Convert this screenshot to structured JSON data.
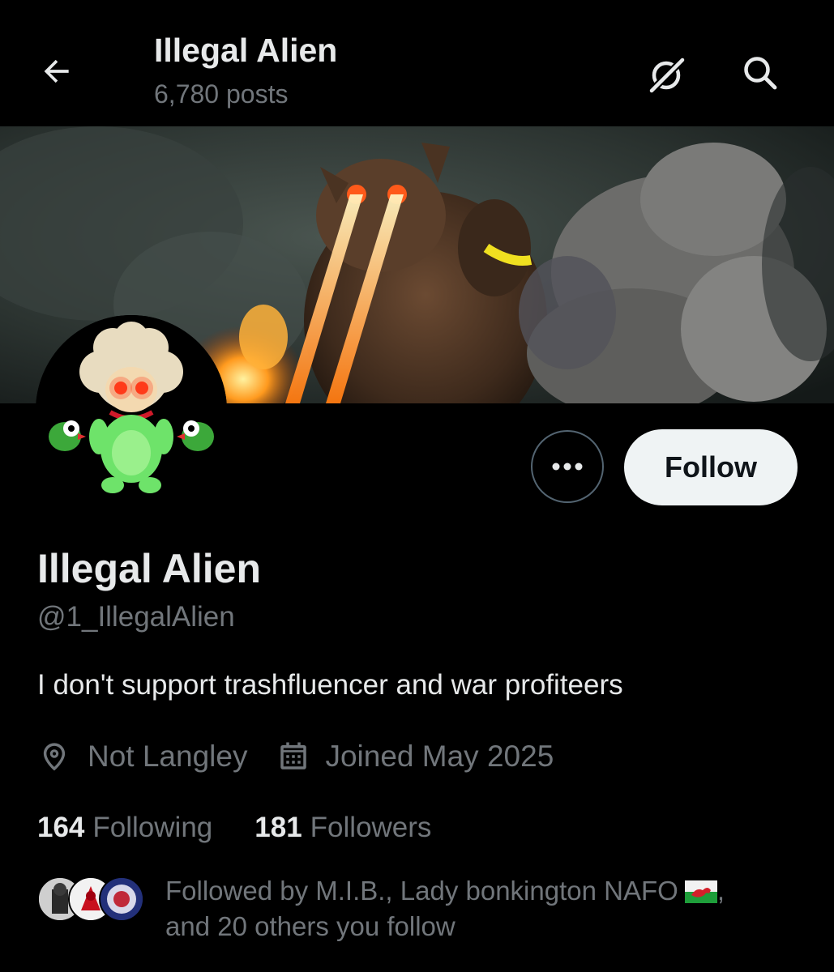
{
  "header": {
    "title": "Illegal Alien",
    "posts_count": "6,780 posts",
    "back_icon": "arrow-left-icon",
    "grok_icon": "grok-icon",
    "search_icon": "search-icon"
  },
  "profile": {
    "display_name": "Illegal Alien",
    "handle": "@1_IllegalAlien",
    "bio": "I don't support trashfluencer and war profiteers",
    "location": "Not Langley",
    "joined": "Joined May 2025",
    "following_count": "164",
    "following_label": "Following",
    "followers_count": "181",
    "followers_label": "Followers"
  },
  "actions": {
    "more_icon": "more-dots-icon",
    "follow_label": "Follow"
  },
  "followed_by": {
    "text_part1": "Followed by M.I.B., Lady bonkington NAFO",
    "text_part2": ",",
    "text_part3": "and 20 others you follow",
    "flag_icon": "wales-flag-icon"
  },
  "colors": {
    "background": "#000000",
    "primary_text": "#e7e9ea",
    "secondary_text": "#71767b",
    "follow_button_bg": "#eff3f4",
    "follow_button_text": "#0f1419",
    "border": "#536471"
  }
}
